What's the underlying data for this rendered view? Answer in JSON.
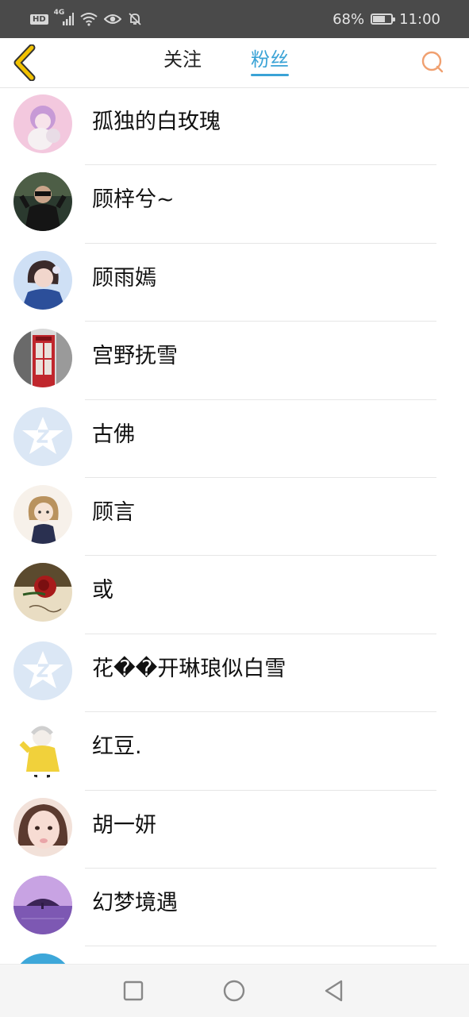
{
  "status_bar": {
    "hd": "HD",
    "network": "4G",
    "battery_percent": "68%",
    "battery_level": 0.68,
    "time": "11:00"
  },
  "header": {
    "tabs": [
      {
        "label": "关注",
        "active": false
      },
      {
        "label": "粉丝",
        "active": true
      }
    ],
    "accent_color": "#3aa3d6",
    "back_color": "#f2c200",
    "search_color": "#f0a070"
  },
  "fans": [
    {
      "name": "孤独的白玫瑰",
      "avatar": "doll-photo"
    },
    {
      "name": "顾梓兮~",
      "avatar": "person-sunglasses-photo"
    },
    {
      "name": "顾雨嫣",
      "avatar": "girl-blue-photo"
    },
    {
      "name": "宫野抚雪",
      "avatar": "red-phone-booth-photo"
    },
    {
      "name": "古佛",
      "avatar": "default-qzone-star"
    },
    {
      "name": "顾言",
      "avatar": "anime-girl"
    },
    {
      "name": "或",
      "avatar": "rose-photo"
    },
    {
      "name": "花��开琳琅似白雪",
      "avatar": "default-qzone-star"
    },
    {
      "name": "红豆.",
      "avatar": "cartoon-kid-yellow"
    },
    {
      "name": "胡一妍",
      "avatar": "girl-face-photo"
    },
    {
      "name": "幻梦境遇",
      "avatar": "purple-sunset-tree"
    },
    {
      "name": "",
      "avatar": "partial-blue"
    }
  ]
}
